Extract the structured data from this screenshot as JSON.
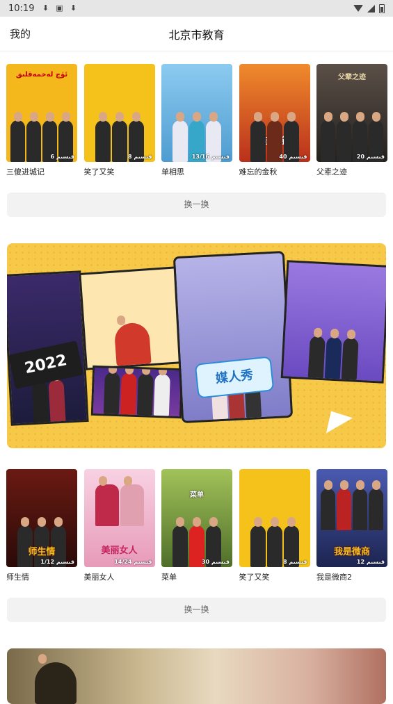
{
  "status_bar": {
    "time": "10:19",
    "icons": [
      "download-icon",
      "a-icon",
      "download-icon",
      "wifi-icon",
      "signal-icon",
      "battery-icon"
    ]
  },
  "header": {
    "left_label": "我的",
    "title": "北京市教育"
  },
  "section1": {
    "items": [
      {
        "name": "三傻进城记",
        "episodes": "6 قىسىم",
        "poster_text": "ئۈچ لەخمەقلىق",
        "bg": "#f5b81c"
      },
      {
        "name": "笑了又笑",
        "episodes": "8 قىسىم",
        "poster_text": "",
        "bg": "#f4c21b"
      },
      {
        "name": "单相思",
        "episodes": "13/16 قىسىم",
        "poster_text": "",
        "bg": "#6fb6e0"
      },
      {
        "name": "难忘的金秋",
        "episodes": "40 قىسىم",
        "poster_text": "难忘的金秋",
        "bg": "#d8572a"
      },
      {
        "name": "父辈之迹",
        "episodes": "20 قىسىم",
        "poster_text": "父辈之迹",
        "bg": "#3b3530"
      }
    ],
    "swap_label": "换一换"
  },
  "banner": {
    "logo_text": "2022",
    "show_logo": "媒人秀"
  },
  "section2": {
    "items": [
      {
        "name": "师生情",
        "episodes": "1/12 قىسىم",
        "poster_text": "师生情",
        "bg": "#5a1a14"
      },
      {
        "name": "美丽女人",
        "episodes": "14/24 قىسىم",
        "poster_text": "美丽女人",
        "bg": "#f4c6d8"
      },
      {
        "name": "菜单",
        "episodes": "30 قىسىم",
        "poster_text": "菜单",
        "bg": "#6f8f3a"
      },
      {
        "name": "笑了又笑",
        "episodes": "8 قىسىم",
        "poster_text": "",
        "bg": "#f4c21b"
      },
      {
        "name": "我是微商2",
        "episodes": "12 قىسىم",
        "poster_text": "我是微商",
        "bg": "#2b3f7a"
      }
    ],
    "swap_label": "换一换"
  }
}
